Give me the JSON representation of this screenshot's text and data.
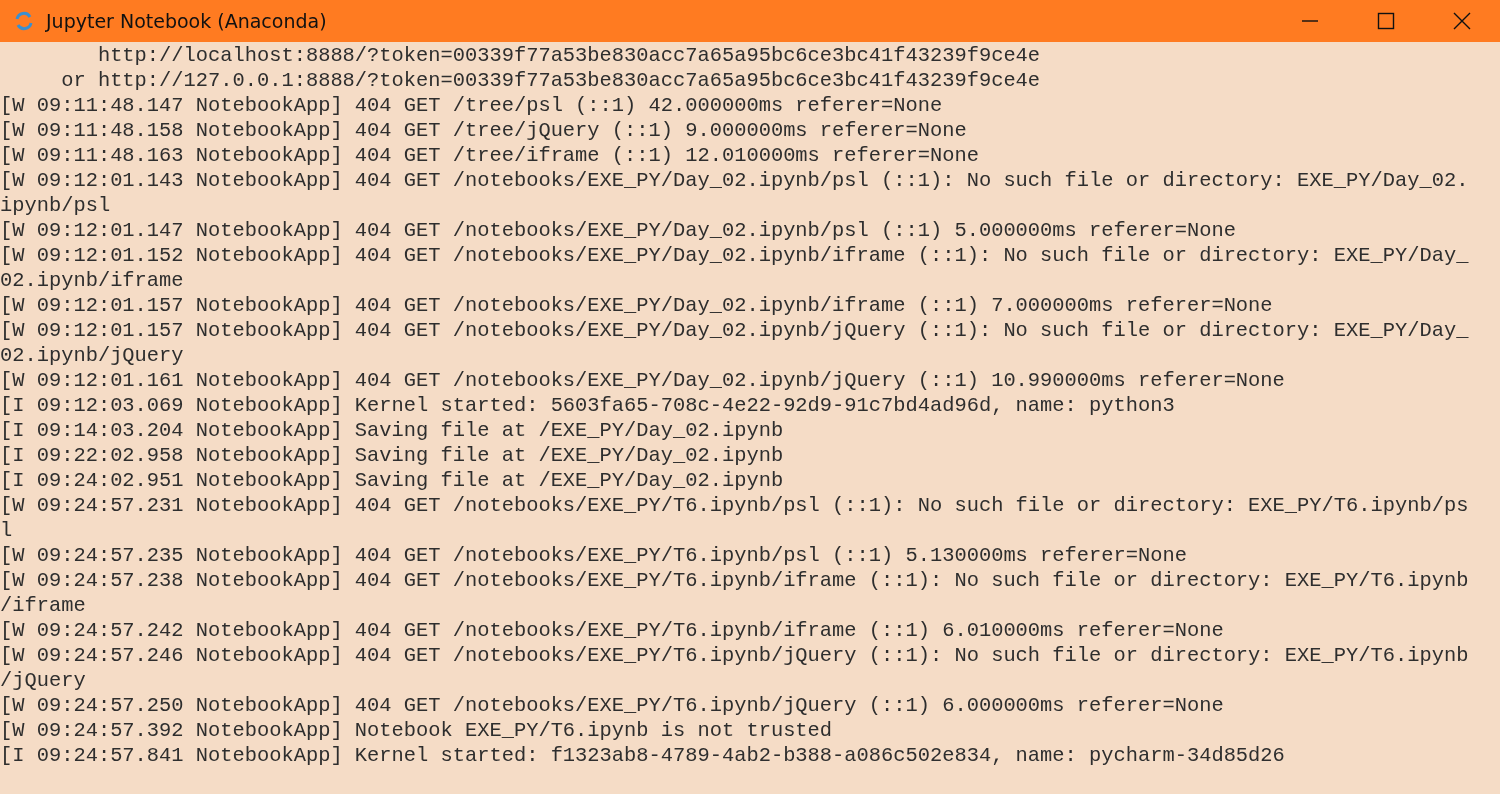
{
  "window": {
    "title": "Jupyter Notebook (Anaconda)"
  },
  "console": {
    "lines": [
      "        http://localhost:8888/?token=00339f77a53be830acc7a65a95bc6ce3bc41f43239f9ce4e",
      "     or http://127.0.0.1:8888/?token=00339f77a53be830acc7a65a95bc6ce3bc41f43239f9ce4e",
      "[W 09:11:48.147 NotebookApp] 404 GET /tree/psl (::1) 42.000000ms referer=None",
      "[W 09:11:48.158 NotebookApp] 404 GET /tree/jQuery (::1) 9.000000ms referer=None",
      "[W 09:11:48.163 NotebookApp] 404 GET /tree/iframe (::1) 12.010000ms referer=None",
      "[W 09:12:01.143 NotebookApp] 404 GET /notebooks/EXE_PY/Day_02.ipynb/psl (::1): No such file or directory: EXE_PY/Day_02.",
      "ipynb/psl",
      "[W 09:12:01.147 NotebookApp] 404 GET /notebooks/EXE_PY/Day_02.ipynb/psl (::1) 5.000000ms referer=None",
      "[W 09:12:01.152 NotebookApp] 404 GET /notebooks/EXE_PY/Day_02.ipynb/iframe (::1): No such file or directory: EXE_PY/Day_",
      "02.ipynb/iframe",
      "[W 09:12:01.157 NotebookApp] 404 GET /notebooks/EXE_PY/Day_02.ipynb/iframe (::1) 7.000000ms referer=None",
      "[W 09:12:01.157 NotebookApp] 404 GET /notebooks/EXE_PY/Day_02.ipynb/jQuery (::1): No such file or directory: EXE_PY/Day_",
      "02.ipynb/jQuery",
      "[W 09:12:01.161 NotebookApp] 404 GET /notebooks/EXE_PY/Day_02.ipynb/jQuery (::1) 10.990000ms referer=None",
      "[I 09:12:03.069 NotebookApp] Kernel started: 5603fa65-708c-4e22-92d9-91c7bd4ad96d, name: python3",
      "[I 09:14:03.204 NotebookApp] Saving file at /EXE_PY/Day_02.ipynb",
      "[I 09:22:02.958 NotebookApp] Saving file at /EXE_PY/Day_02.ipynb",
      "[I 09:24:02.951 NotebookApp] Saving file at /EXE_PY/Day_02.ipynb",
      "[W 09:24:57.231 NotebookApp] 404 GET /notebooks/EXE_PY/T6.ipynb/psl (::1): No such file or directory: EXE_PY/T6.ipynb/ps",
      "l",
      "[W 09:24:57.235 NotebookApp] 404 GET /notebooks/EXE_PY/T6.ipynb/psl (::1) 5.130000ms referer=None",
      "[W 09:24:57.238 NotebookApp] 404 GET /notebooks/EXE_PY/T6.ipynb/iframe (::1): No such file or directory: EXE_PY/T6.ipynb",
      "/iframe",
      "[W 09:24:57.242 NotebookApp] 404 GET /notebooks/EXE_PY/T6.ipynb/iframe (::1) 6.010000ms referer=None",
      "[W 09:24:57.246 NotebookApp] 404 GET /notebooks/EXE_PY/T6.ipynb/jQuery (::1): No such file or directory: EXE_PY/T6.ipynb",
      "/jQuery",
      "[W 09:24:57.250 NotebookApp] 404 GET /notebooks/EXE_PY/T6.ipynb/jQuery (::1) 6.000000ms referer=None",
      "[W 09:24:57.392 NotebookApp] Notebook EXE_PY/T6.ipynb is not trusted",
      "[I 09:24:57.841 NotebookApp] Kernel started: f1323ab8-4789-4ab2-b388-a086c502e834, name: pycharm-34d85d26"
    ]
  }
}
